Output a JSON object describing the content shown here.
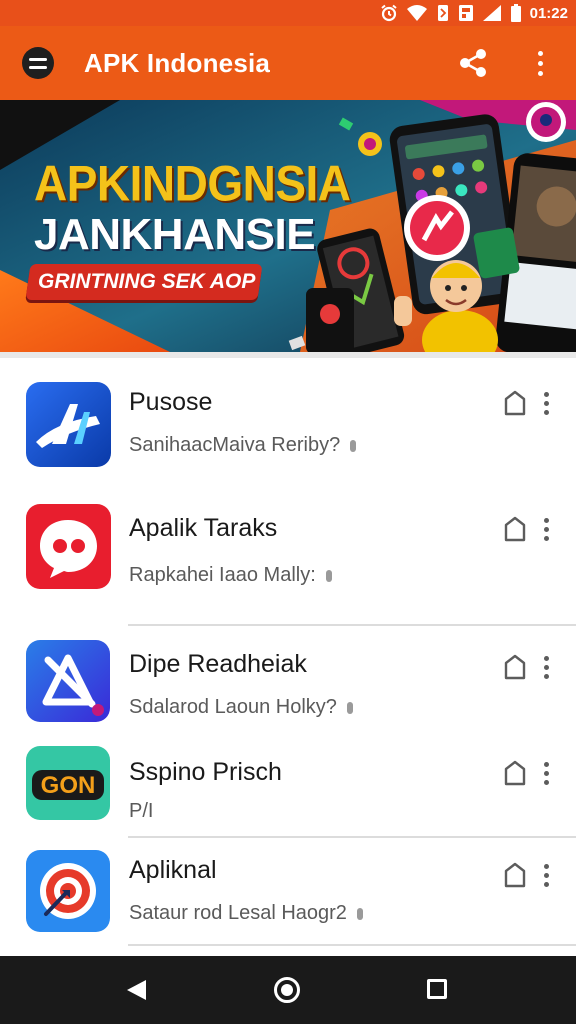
{
  "status_bar": {
    "time": "01:22",
    "icons": [
      "alarm-icon",
      "wifi-icon",
      "vibrate-icon",
      "nfc-icon",
      "signal-icon",
      "battery-icon"
    ]
  },
  "app_bar": {
    "title": "APK Indonesia",
    "icons": [
      "menu-icon",
      "share-icon",
      "more-vert-icon"
    ],
    "background": "#ec5a16"
  },
  "banner": {
    "line1": "APKINDGNSIA",
    "line2": "JANKHANSIE",
    "ribbon": "GRINTNING SEK AOP"
  },
  "apps": [
    {
      "name": "Pusose",
      "subtitle": "SanihaacMaiva Reriby?",
      "icon": "stylized-a-logo-icon"
    },
    {
      "name": "Apalik Taraks",
      "subtitle": "Rapkahei Iaao Mally:",
      "icon": "chat-bubble-logo-icon"
    },
    {
      "name": "Dipe Readheiak",
      "subtitle": "Sdalarod Laoun Holky?",
      "icon": "crossed-triangle-logo-icon"
    },
    {
      "name": "Sspino Prisch",
      "subtitle": "P/I",
      "icon": "gon-logo-icon"
    },
    {
      "name": "Apliknal",
      "subtitle": "Sataur rod Lesal Haogr2",
      "icon": "target-arrow-logo-icon"
    }
  ],
  "nav_bar": {
    "icons": [
      "back-icon",
      "home-icon",
      "recents-icon"
    ]
  },
  "colors": {
    "accent": "#ec5a16",
    "status_bar": "#e8501a",
    "nav_bar": "#1a1a1a"
  }
}
